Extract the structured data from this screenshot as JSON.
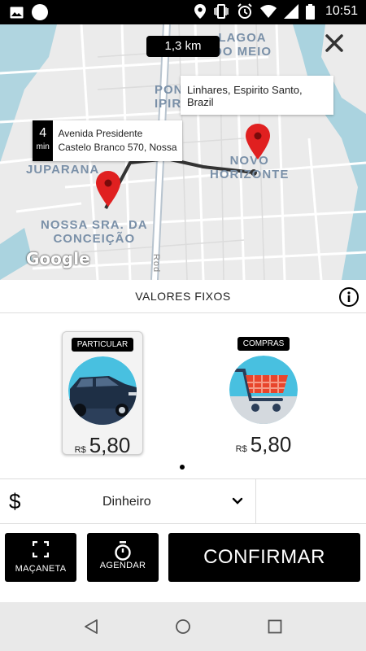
{
  "status_bar": {
    "time": "10:51",
    "icons_left": [
      "image-icon",
      "circle-icon"
    ],
    "icons_right": [
      "location-icon",
      "vibrate-icon",
      "alarm-icon",
      "wifi-icon",
      "signal-icon",
      "battery-icon"
    ]
  },
  "map": {
    "distance": "1,3 km",
    "destination_callout": "Linhares, Espirito Santo, Brazil",
    "eta": {
      "value": "4",
      "unit": "min"
    },
    "origin_address": "Avenida Presidente Castelo Branco 570, Nossa",
    "labels": {
      "lagoa": "LAGOA\nDO MEIO",
      "ponte": "PON\nIPIR",
      "novo": "NOVO\nHORIZONTE",
      "juparana": "JUPARANA",
      "nossa": "NOSSA SRA. DA\nCONCEIÇÃO",
      "road": "Rod"
    },
    "attribution": "Google",
    "route_color": "#333333",
    "pin_color": "#e02020"
  },
  "fixed_values": {
    "title": "VALORES FIXOS",
    "info_icon": "info-icon"
  },
  "cards": [
    {
      "tag": "PARTICULAR",
      "currency": "R$",
      "price": "5,80",
      "selected": true,
      "image": "car-illustration"
    },
    {
      "tag": "COMPRAS",
      "currency": "R$",
      "price": "5,80",
      "selected": false,
      "image": "shopping-cart-illustration"
    }
  ],
  "payment": {
    "symbol": "$",
    "method": "Dinheiro",
    "chevron_icon": "chevron-down-icon"
  },
  "buttons": {
    "handle": "MAÇANETA",
    "schedule": "AGENDAR",
    "confirm": "CONFIRMAR"
  },
  "nav": [
    "back-icon",
    "home-icon",
    "recents-icon"
  ]
}
